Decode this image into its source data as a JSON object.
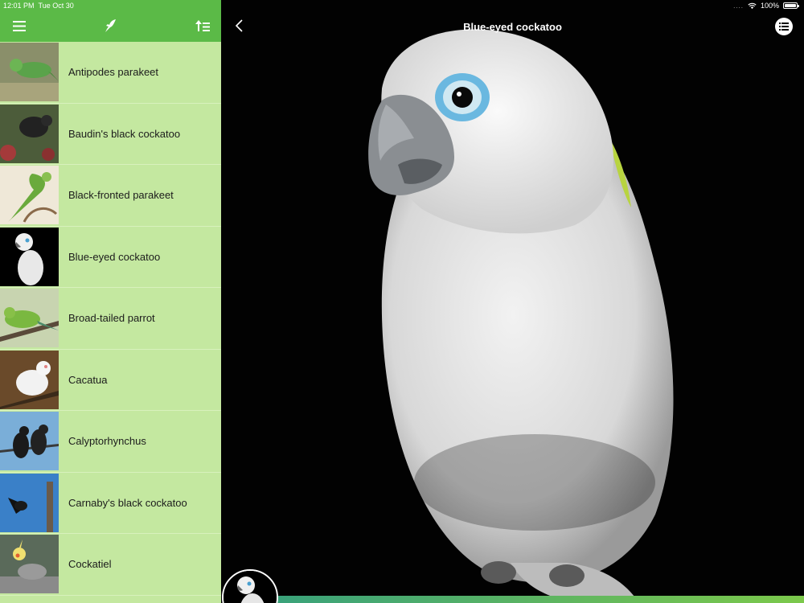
{
  "status": {
    "time": "12:01 PM",
    "date": "Tue Oct 30",
    "battery": "100%",
    "signal": "....",
    "wifi_icon": "wifi-icon"
  },
  "sidebar": {
    "header_icons": [
      "menu-icon",
      "bird-icon",
      "sort-icon"
    ],
    "items": [
      {
        "label": "Antipodes parakeet"
      },
      {
        "label": "Baudin's black cockatoo"
      },
      {
        "label": "Black-fronted parakeet"
      },
      {
        "label": "Blue-eyed cockatoo"
      },
      {
        "label": "Broad-tailed parrot"
      },
      {
        "label": "Cacatua"
      },
      {
        "label": "Calyptorhynchus"
      },
      {
        "label": "Carnaby's black cockatoo"
      },
      {
        "label": "Cockatiel"
      }
    ]
  },
  "detail": {
    "title": "Blue-eyed cockatoo",
    "back_icon": "chevron-left-icon",
    "list_icon": "list-icon"
  },
  "colors": {
    "header_green": "#5bba47",
    "list_bg": "#c4e8a0",
    "accent": "#63b85d"
  }
}
